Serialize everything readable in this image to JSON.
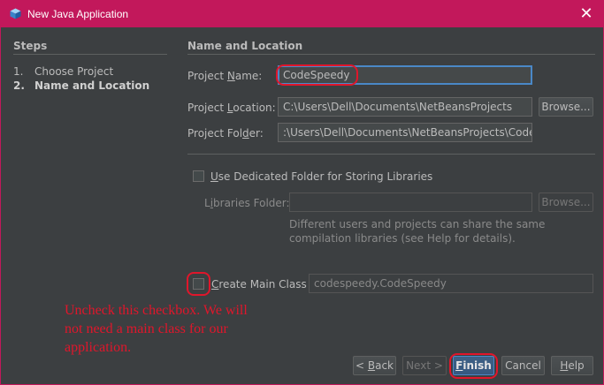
{
  "window": {
    "title": "New Java Application",
    "close_glyph": "✕",
    "accent": "#c2185b",
    "app_icon": "java-cube-icon"
  },
  "steps": {
    "heading": "Steps",
    "items": [
      {
        "num": "1.",
        "label": "Choose Project"
      },
      {
        "num": "2.",
        "label": "Name and Location"
      }
    ]
  },
  "section": {
    "heading": "Name and Location"
  },
  "form": {
    "project_name": {
      "label_pre": "Project ",
      "label_mnemonic": "N",
      "label_post": "ame:",
      "value": "CodeSpeedy"
    },
    "project_location": {
      "label_pre": "Project ",
      "label_mnemonic": "L",
      "label_post": "ocation:",
      "value": "C:\\Users\\Dell\\Documents\\NetBeansProjects"
    },
    "project_folder": {
      "label_pre": "Project Fol",
      "label_mnemonic": "d",
      "label_post": "er:",
      "value": ":\\Users\\Dell\\Documents\\NetBeansProjects\\CodeS"
    },
    "browse_label": "Browse...",
    "dedicated_folder": {
      "mnemonic": "U",
      "label_post": "se Dedicated Folder for Storing Libraries",
      "checked": false
    },
    "libraries_folder": {
      "label_pre": "L",
      "label_mnemonic": "i",
      "label_post": "braries Folder:",
      "value": ""
    },
    "libraries_browse_label": "Browse...",
    "hint": "Different users and projects can share the same compilation libraries (see Help for details).",
    "main_class": {
      "mnemonic": "C",
      "label_post": "reate Main Class",
      "checked": false,
      "value": "codespeedy.CodeSpeedy"
    }
  },
  "buttons": {
    "back": {
      "prefix": "< ",
      "mnemonic": "B",
      "rest": "ack"
    },
    "next": "Next >",
    "finish": {
      "mnemonic": "F",
      "rest": "inish"
    },
    "cancel": "Cancel",
    "help": {
      "mnemonic": "H",
      "rest": "elp"
    }
  },
  "annotation": {
    "text": "Uncheck this checkbox. We will not need a main class for our application.",
    "color": "#e0162b"
  }
}
